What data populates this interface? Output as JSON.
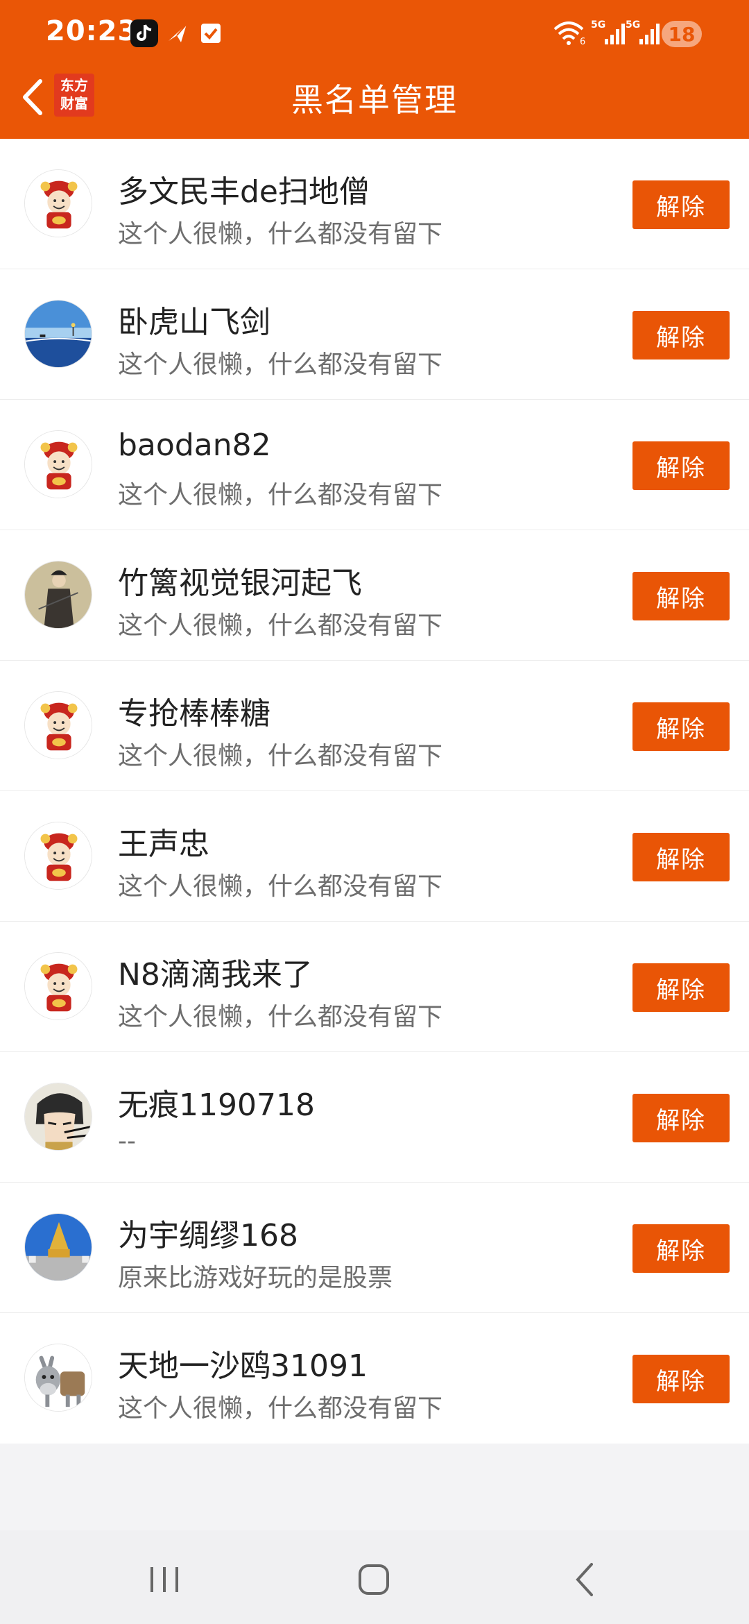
{
  "status_bar": {
    "time": "20:23",
    "battery": "18",
    "net1": "5G",
    "net2": "5G",
    "wifi_badge": "6"
  },
  "header": {
    "title": "黑名单管理",
    "logo_line1": "东方",
    "logo_line2": "财富"
  },
  "colors": {
    "brand": "#ea5606",
    "button": "#e95506",
    "text": "#222222",
    "subtext": "#6e6e6e"
  },
  "unblock_label": "解除",
  "users": [
    {
      "name": "多文民丰de扫地僧",
      "signature": "这个人很懒，什么都没有留下",
      "avatar": "default-mascot"
    },
    {
      "name": "卧虎山飞剑",
      "signature": "这个人很懒，什么都没有留下",
      "avatar": "sea-landscape"
    },
    {
      "name": "baodan82",
      "signature": "这个人很懒，什么都没有留下",
      "avatar": "default-mascot"
    },
    {
      "name": "竹篱视觉银河起飞",
      "signature": "这个人很懒，什么都没有留下",
      "avatar": "swordsman"
    },
    {
      "name": "专抢棒棒糖",
      "signature": "这个人很懒，什么都没有留下",
      "avatar": "default-mascot"
    },
    {
      "name": "王声忠",
      "signature": "这个人很懒，什么都没有留下",
      "avatar": "default-mascot"
    },
    {
      "name": "N8滴滴我来了",
      "signature": "这个人很懒，什么都没有留下",
      "avatar": "default-mascot"
    },
    {
      "name": "无痕1190718",
      "signature": "--",
      "avatar": "anime-face"
    },
    {
      "name": "为宇绸缪168",
      "signature": "原来比游戏好玩的是股票",
      "avatar": "temple"
    },
    {
      "name": "天地一沙鸥31091",
      "signature": "这个人很懒，什么都没有留下",
      "avatar": "donkey"
    }
  ]
}
